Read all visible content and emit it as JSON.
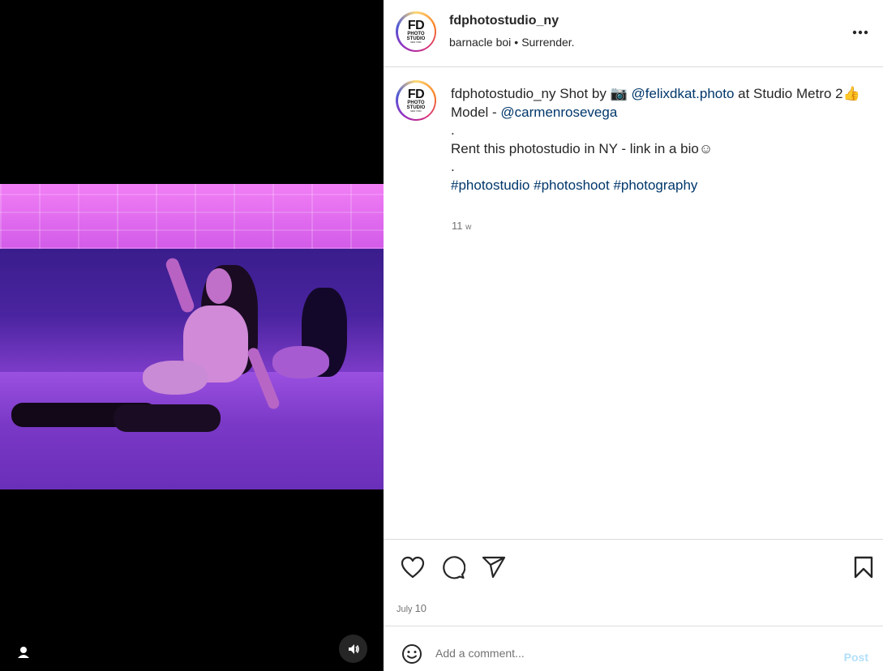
{
  "header": {
    "username": "fdphotostudio_ny",
    "audio_artist": "barnacle boi",
    "audio_separator": "•",
    "audio_track": "Surrender.",
    "more_icon": "more-horizontal-icon"
  },
  "avatar": {
    "logo_line1": "FD",
    "logo_line2": "PHOTO",
    "logo_line3": "STUDIO",
    "logo_line4": "NEW YORK"
  },
  "caption": {
    "username": "fdphotostudio_ny",
    "text_shot_by": "Shot by",
    "camera_emoji": "📷",
    "photographer": "@felixdkat.photo",
    "text_at": "at Studio Metro 2👍",
    "model_label": "Model -",
    "model_handle": "@carmenrosevega",
    "dot1": ".",
    "rent_text": "Rent this photostudio in NY - link in a bio☺",
    "dot2": ".",
    "hashtags": [
      "#photostudio",
      "#photoshoot",
      "#photography"
    ],
    "time_ago": "11",
    "time_unit": "w"
  },
  "actions": {
    "like_icon": "heart-icon",
    "comment_icon": "comment-icon",
    "share_icon": "share-icon",
    "save_icon": "bookmark-icon",
    "date_month": "July",
    "date_day": "10"
  },
  "comment": {
    "emoji_icon": "smiley-icon",
    "placeholder": "Add a comment...",
    "post_label": "Post"
  },
  "media": {
    "user_icon": "user-tag-icon",
    "audio_icon": "volume-icon"
  },
  "colors": {
    "link": "#00376b",
    "muted": "#737373",
    "post_disabled": "#b2dffc",
    "divider": "#dbdbdb"
  }
}
